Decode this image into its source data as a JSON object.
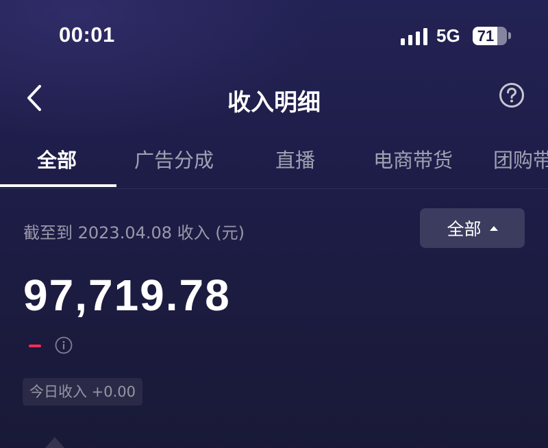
{
  "status_bar": {
    "time": "00:01",
    "network": "5G",
    "battery_percent": 71,
    "battery_label": "71",
    "signal_bars": 4
  },
  "header": {
    "title": "收入明细",
    "back_icon": "chevron-left-icon",
    "help_icon": "question-circle-icon"
  },
  "tabs": [
    {
      "label": "全部",
      "active": true
    },
    {
      "label": "广告分成",
      "active": false
    },
    {
      "label": "直播",
      "active": false
    },
    {
      "label": "电商带货",
      "active": false
    },
    {
      "label": "团购带",
      "active": false
    }
  ],
  "summary": {
    "as_of_label": "截至到 2023.04.08 收入 (元)",
    "filter_label": "全部",
    "total_amount": "97,719.78",
    "change_indicator": "–",
    "today_income": "今日收入 +0.00"
  },
  "colors": {
    "background_top": "#232254",
    "background_bottom": "#191937",
    "accent_red": "#ff2c55",
    "text_primary": "#ffffff"
  }
}
